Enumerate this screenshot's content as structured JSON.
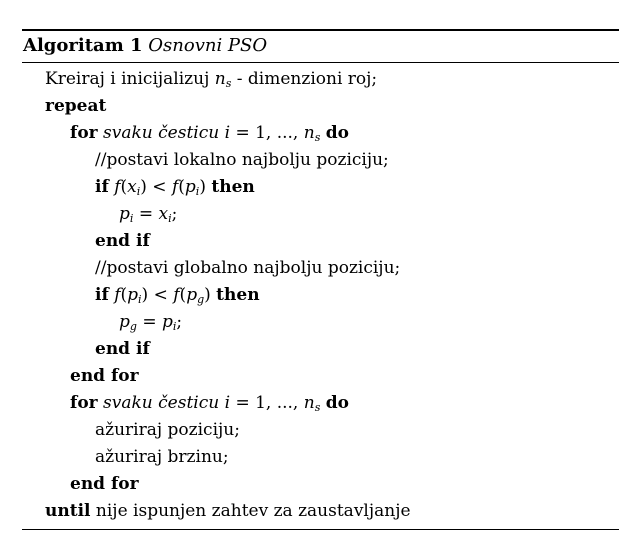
{
  "algorithm": {
    "label": "Algoritam 1",
    "title": "Osnovni PSO"
  },
  "lines": {
    "l1": {
      "text": "Kreiraj i inicijalizuj",
      "var": "n",
      "sub": "s",
      "rest": "- dimenzioni roj;"
    },
    "l2": {
      "kw": "repeat"
    },
    "l3": {
      "kw": "for",
      "it": "svaku česticu",
      "math": "i",
      "eq": "= 1, ...,",
      "var": "n",
      "sub": "s",
      "kw2": "do"
    },
    "l4": {
      "text": "//postavi lokalno najbolju poziciju;"
    },
    "l5": {
      "kw": "if",
      "f": "f",
      "x": "x",
      "xsub": "i",
      "op": "<",
      "p": "p",
      "psub": "i",
      "kw2": "then"
    },
    "l6": {
      "lhs": "p",
      "lsub": "i",
      "eq": "=",
      "rhs": "x",
      "rsub": "i",
      "end": ";"
    },
    "l7": {
      "kw": "end if"
    },
    "l8": {
      "text": "//postavi globalno najbolju poziciju;"
    },
    "l9": {
      "kw": "if",
      "f": "f",
      "p": "p",
      "psub": "i",
      "op": "<",
      "g": "p",
      "gsub": "g",
      "kw2": "then"
    },
    "l10": {
      "lhs": "p",
      "lsub": "g",
      "eq": "=",
      "rhs": "p",
      "rsub": "i",
      "end": ";"
    },
    "l11": {
      "kw": "end if"
    },
    "l12": {
      "kw": "end for"
    },
    "l13": {
      "kw": "for",
      "it": "svaku česticu",
      "math": "i",
      "eq": "= 1, ...,",
      "var": "n",
      "sub": "s",
      "kw2": "do"
    },
    "l14": {
      "text": "ažuriraj poziciju;"
    },
    "l15": {
      "text": "ažuriraj brzinu;"
    },
    "l16": {
      "kw": "end for"
    },
    "l17": {
      "kw": "until",
      "text": "nije ispunjen zahtev za zaustavljanje"
    }
  }
}
